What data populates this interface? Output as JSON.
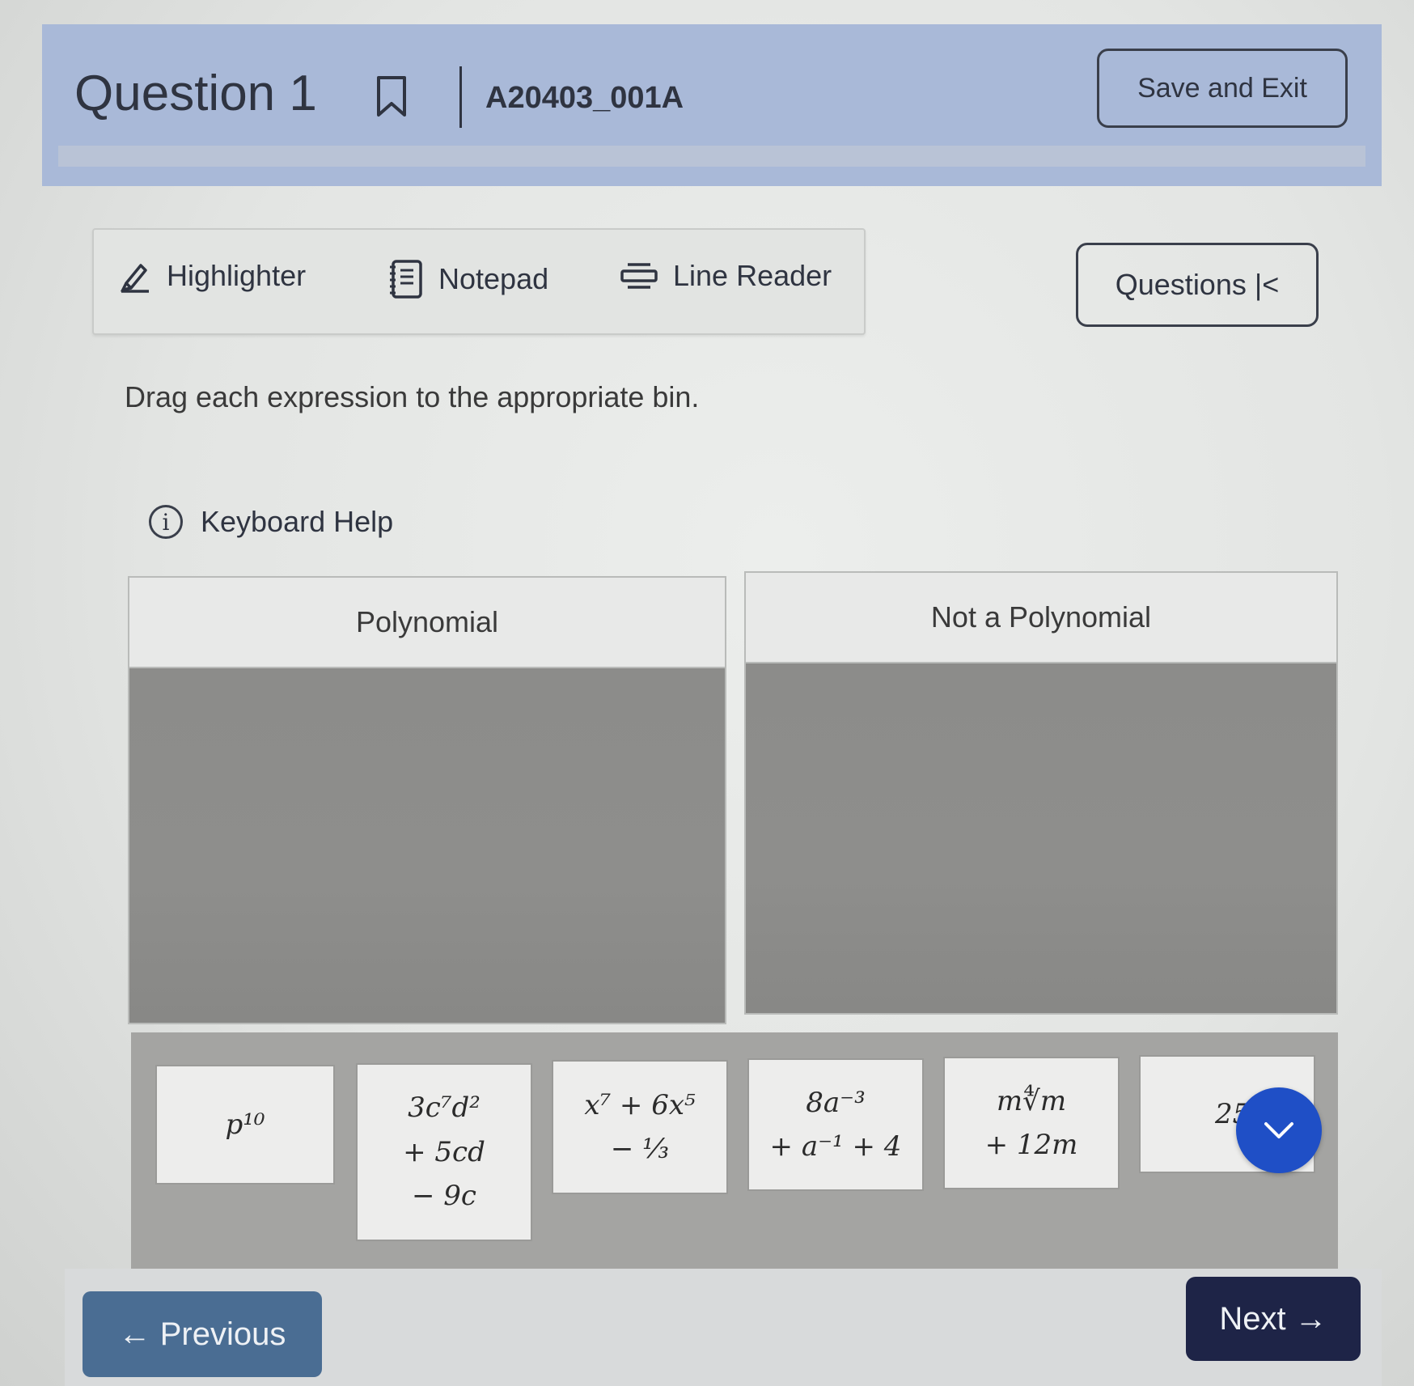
{
  "header": {
    "question_title": "Question 1",
    "item_id": "A20403_001A",
    "save_exit_label": "Save and Exit"
  },
  "toolbar": {
    "highlighter_label": "Highlighter",
    "notepad_label": "Notepad",
    "line_reader_label": "Line Reader",
    "questions_label": "Questions |<"
  },
  "prompt": {
    "instruction": "Drag each expression to the appropriate bin.",
    "keyboard_help": "Keyboard Help"
  },
  "bins": [
    {
      "label": "Polynomial"
    },
    {
      "label": "Not a Polynomial"
    }
  ],
  "expressions": [
    {
      "lines": [
        "p¹⁰"
      ]
    },
    {
      "lines": [
        "3c⁷d²",
        "+ 5cd",
        "− 9c"
      ]
    },
    {
      "lines": [
        "x⁷ + 6x⁵",
        "− ⅓"
      ]
    },
    {
      "lines": [
        "8a⁻³",
        "+ a⁻¹ + 4"
      ]
    },
    {
      "lines": [
        "m∜m",
        "+ 12m"
      ]
    },
    {
      "lines": [
        "25"
      ]
    }
  ],
  "footer": {
    "previous_label": "← Previous",
    "next_label": "Next →"
  },
  "colors": {
    "header_bg": "#a9b9d8",
    "scroll_button": "#1f4fc6",
    "previous_button": "#4a6d93",
    "next_button": "#1e2447"
  }
}
